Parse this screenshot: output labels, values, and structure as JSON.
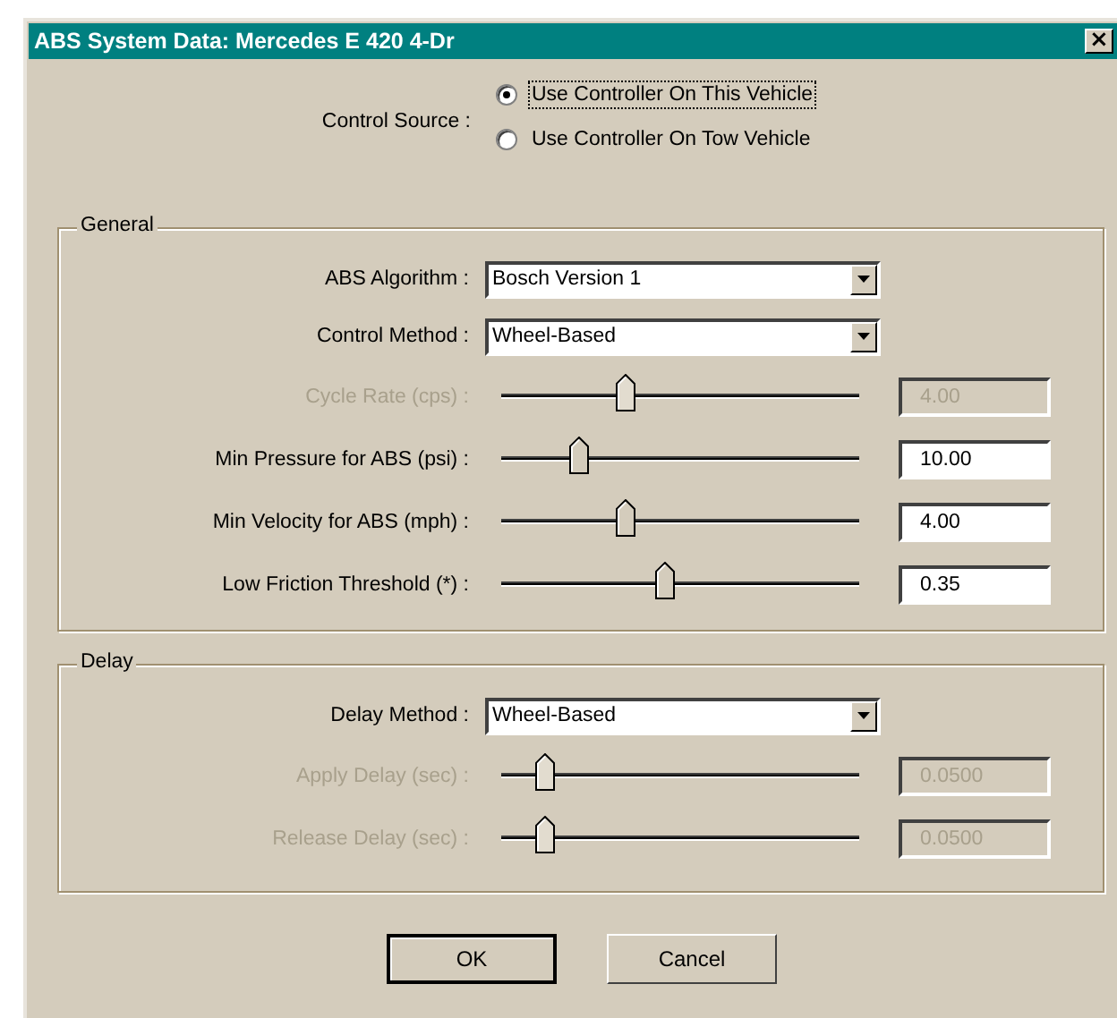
{
  "window": {
    "title": "ABS System Data: Mercedes E 420 4-Dr",
    "close": "×"
  },
  "control_source": {
    "label": "Control Source :",
    "options": [
      {
        "label": "Use Controller On This Vehicle",
        "selected": true
      },
      {
        "label": "Use Controller On Tow Vehicle",
        "selected": false
      }
    ]
  },
  "groups": [
    {
      "title": "General",
      "rows": [
        {
          "kind": "dropdown",
          "label": "ABS Algorithm :",
          "value": "Bosch Version 1",
          "disabled": false
        },
        {
          "kind": "dropdown",
          "label": "Control Method :",
          "value": "Wheel-Based",
          "disabled": false
        },
        {
          "kind": "slider",
          "label": "Cycle Rate (cps) :",
          "level": 0.345,
          "value": "4.00",
          "disabled": true
        },
        {
          "kind": "slider",
          "label": "Min Pressure for ABS (psi) :",
          "level": 0.215,
          "value": "10.00",
          "disabled": false
        },
        {
          "kind": "slider",
          "label": "Min Velocity for ABS (mph) :",
          "level": 0.345,
          "value": "4.00",
          "disabled": false
        },
        {
          "kind": "slider",
          "label": "Low Friction Threshold (*) :",
          "level": 0.455,
          "value": "0.35",
          "disabled": false
        }
      ]
    },
    {
      "title": "Delay",
      "rows": [
        {
          "kind": "dropdown",
          "label": "Delay Method :",
          "value": "Wheel-Based",
          "disabled": false
        },
        {
          "kind": "slider",
          "label": "Apply Delay (sec) :",
          "level": 0.12,
          "value": "0.0500",
          "disabled": true
        },
        {
          "kind": "slider",
          "label": "Release Delay (sec) :",
          "level": 0.12,
          "value": "0.0500",
          "disabled": true
        }
      ]
    }
  ],
  "buttons": [
    {
      "label": "OK",
      "default": true
    },
    {
      "label": "Cancel",
      "default": false
    }
  ]
}
